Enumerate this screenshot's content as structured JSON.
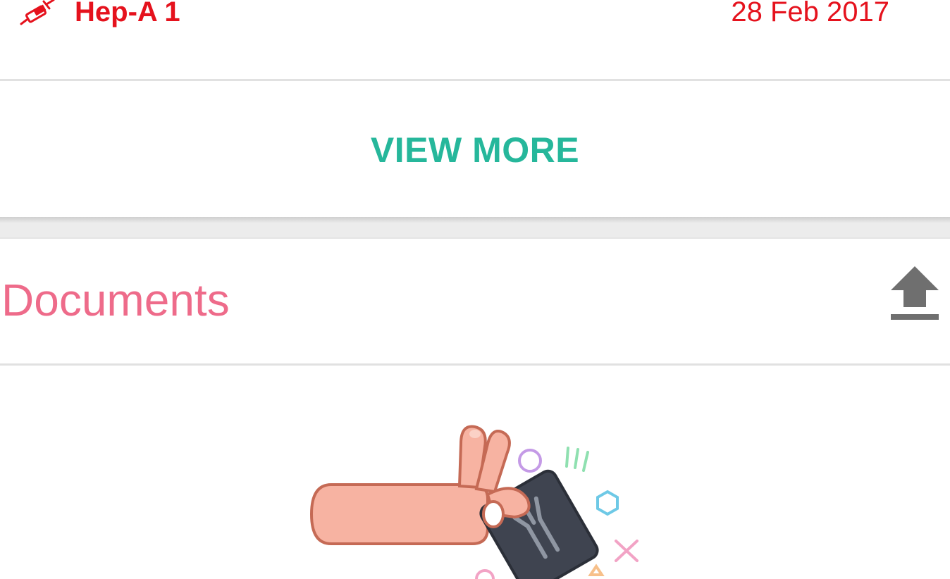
{
  "vaccination": {
    "icon": "syringe-icon",
    "name": "Hep-A 1",
    "date": "28 Feb 2017",
    "color": "#e5121d"
  },
  "view_more": {
    "label": "VIEW MORE",
    "color": "#26b79b"
  },
  "documents": {
    "title": "Documents",
    "title_color": "#ee6b8a",
    "upload_icon": "upload-icon",
    "empty_illustration": "hand-holding-xray-illustration"
  }
}
